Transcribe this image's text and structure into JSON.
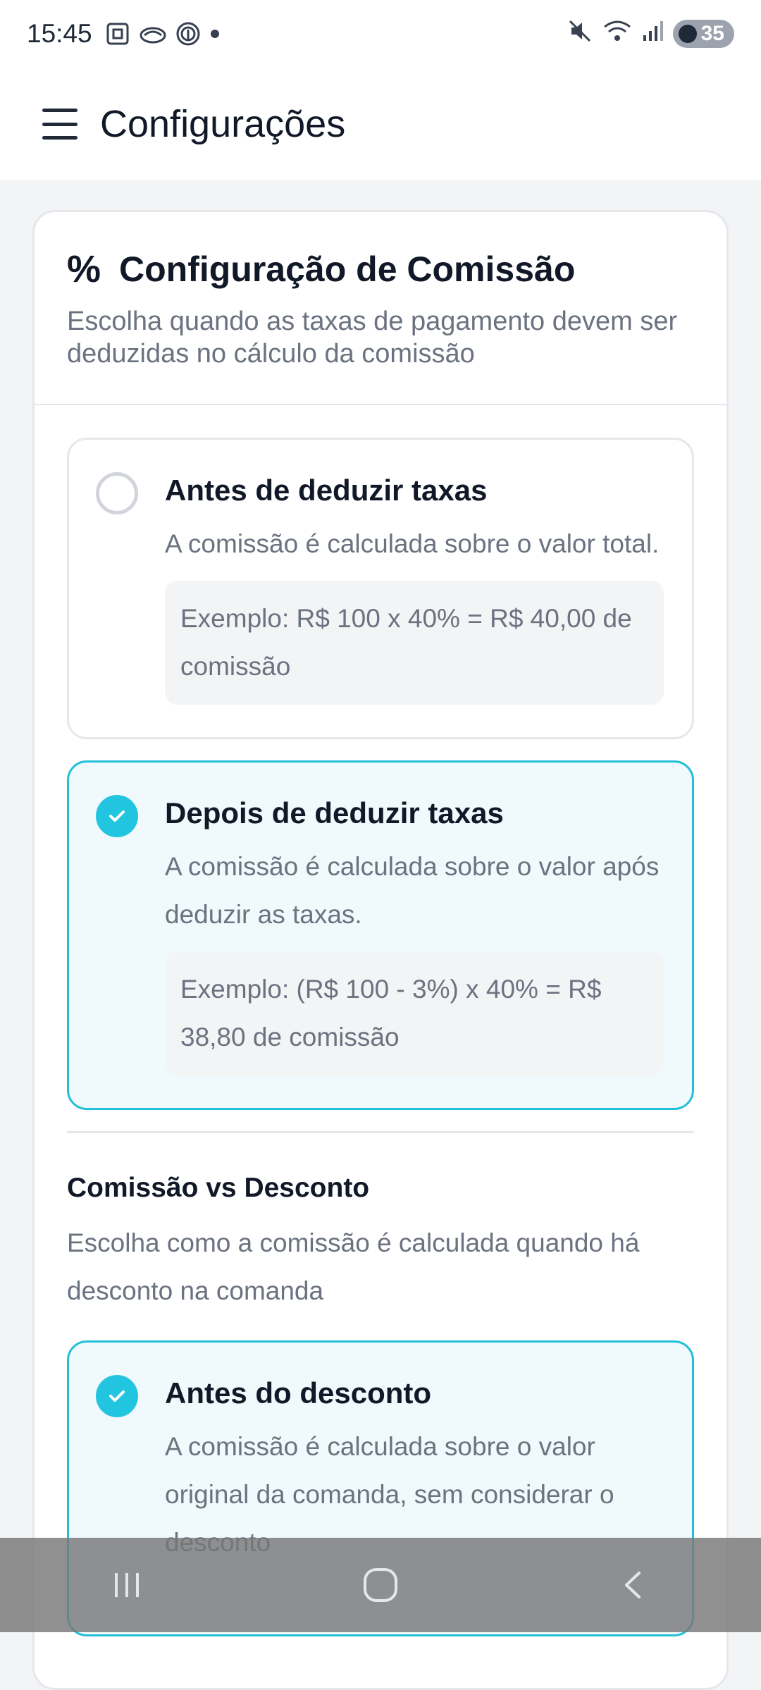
{
  "status_bar": {
    "time": "15:45",
    "battery": "35"
  },
  "app_bar": {
    "title": "Configurações"
  },
  "card": {
    "title": "Configuração de Comissão",
    "subtitle": "Escolha quando as taxas de pagamento devem ser deduzidas no cálculo da comissão",
    "fee_options": [
      {
        "title": "Antes de deduzir taxas",
        "description": "A comissão é calculada sobre o valor total.",
        "example": "Exemplo: R$ 100 x 40% = R$ 40,00 de comissão",
        "selected": false
      },
      {
        "title": "Depois de deduzir taxas",
        "description": "A comissão é calculada sobre o valor após deduzir as taxas.",
        "example": "Exemplo: (R$ 100 - 3%) x 40% = R$ 38,80 de comissão",
        "selected": true
      }
    ],
    "discount_section": {
      "title": "Comissão vs Desconto",
      "description": "Escolha como a comissão é calculada quando há desconto na comanda",
      "options": [
        {
          "title": "Antes do desconto",
          "description": "A comissão é calculada sobre o valor original da comanda, sem considerar o desconto",
          "selected": true
        }
      ]
    }
  },
  "colors": {
    "accent": "#22c5e0",
    "selected_bg": "#f0f9fc",
    "border": "#e5e7eb"
  }
}
